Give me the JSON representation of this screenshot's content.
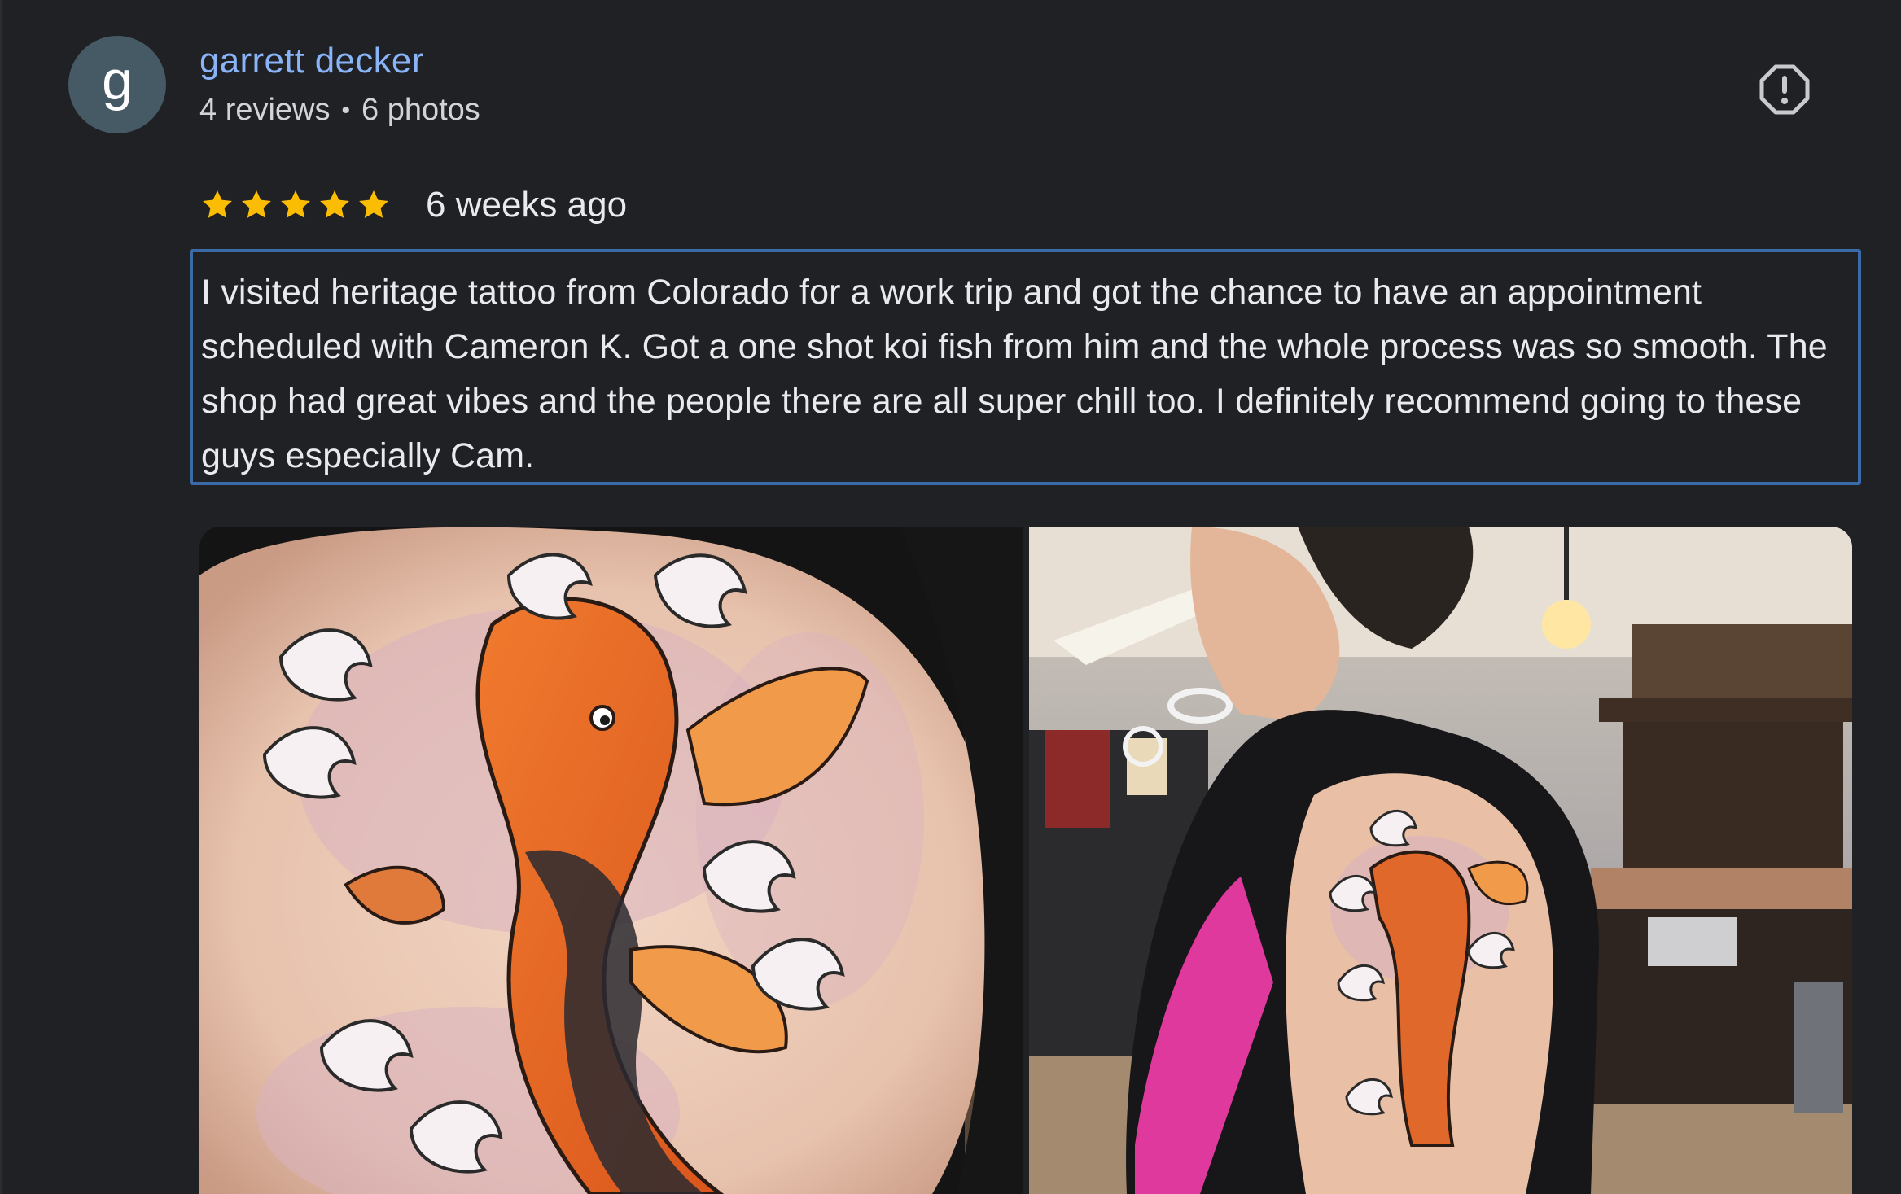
{
  "reviewer": {
    "avatar_letter": "g",
    "name": "garrett decker",
    "reviews": "4 reviews",
    "separator": "•",
    "photos": "6 photos"
  },
  "review": {
    "rating": 5,
    "rating_max": 5,
    "date": "6 weeks ago",
    "text": "I visited heritage tattoo from Colorado for a work trip and got the chance to have an appointment scheduled with Cameron K. Got a one shot koi fish from him and the whole process was so smooth. The shop had great vibes and the people there are all super chill too. I definitely recommend going to these guys especially Cam."
  },
  "icons": {
    "report": "report-flag-icon",
    "star": "star-icon"
  },
  "colors": {
    "background": "#202124",
    "name_link": "#8ab4f8",
    "star": "#fbbc04",
    "focus_border": "#3a6ba8",
    "avatar": "#455a64"
  },
  "photos": [
    {
      "subject": "koi fish tattoo close-up"
    },
    {
      "subject": "tattooed arm in tattoo shop"
    }
  ]
}
